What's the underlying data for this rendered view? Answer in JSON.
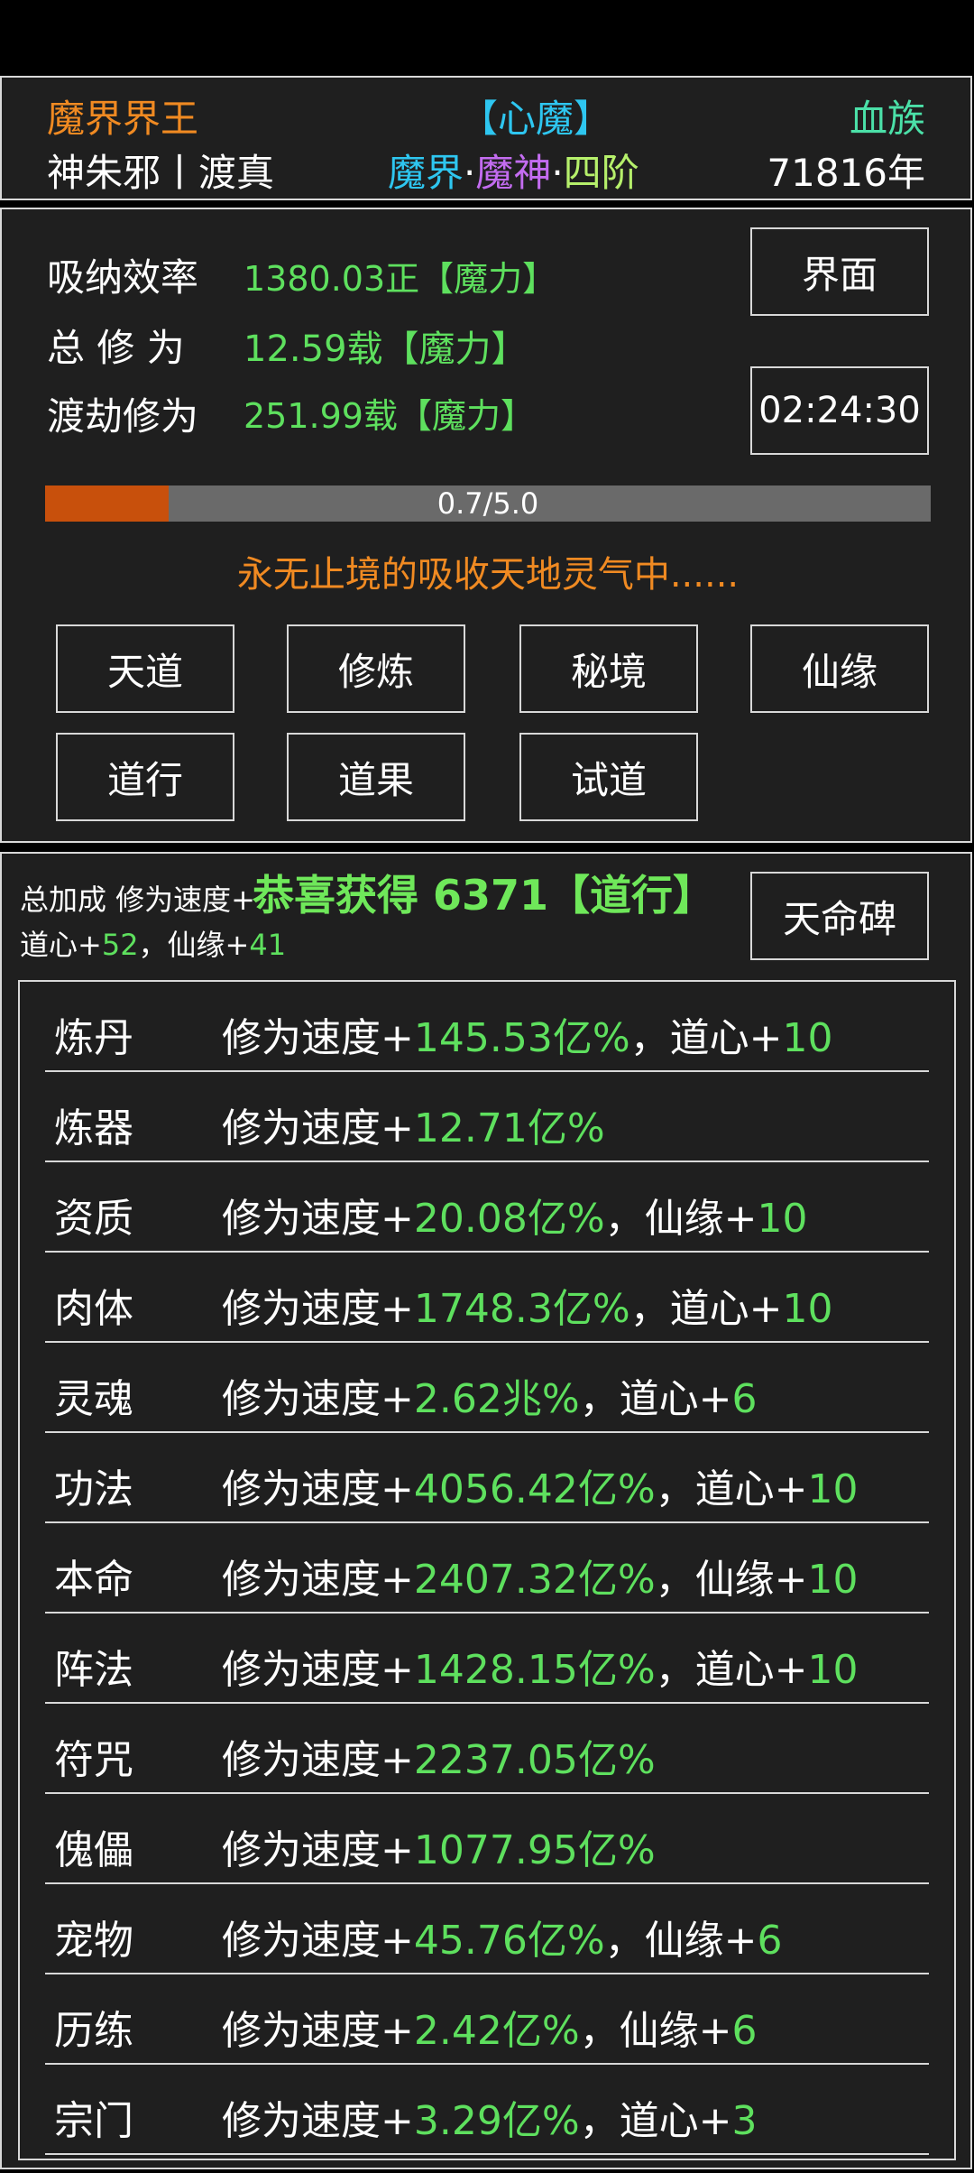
{
  "header": {
    "title": "魔界界王",
    "heart_demon": "【心魔】",
    "race": "血族",
    "name": "神朱邪丨渡真",
    "realm": {
      "world": "魔界",
      "dot1": "·",
      "rank": "魔神",
      "dot2": "·",
      "stage": "四阶"
    },
    "age": "71816年"
  },
  "stats": {
    "absorb_label": "吸纳效率",
    "absorb_value": "1380.03正【魔力】",
    "total_label": "总 修 为",
    "total_value": "12.59载【魔力】",
    "tribulation_label": "渡劫修为",
    "tribulation_value": "251.99载【魔力】",
    "interface_button": "界面",
    "timer": "02:24:30"
  },
  "progress": {
    "text": "0.7/5.0",
    "value": 0.7,
    "max": 5.0
  },
  "status_message": "永无止境的吸收天地灵气中......",
  "actions": [
    "天道",
    "修炼",
    "秘境",
    "仙缘",
    "道行",
    "道果",
    "试道"
  ],
  "bonus": {
    "prefix": "总加成 修为速度+",
    "toast": "恭喜获得 6371【道行】",
    "line2_a": "道心+",
    "line2_b": "52",
    "line2_c": "，仙缘+",
    "line2_d": "41",
    "tablet_button": "天命碑"
  },
  "bonus_list": [
    {
      "name": "炼丹",
      "a": "修为速度+",
      "b": "145.53亿%",
      "c": "，道心+",
      "d": "10"
    },
    {
      "name": "炼器",
      "a": "修为速度+",
      "b": "12.71亿%",
      "c": "",
      "d": ""
    },
    {
      "name": "资质",
      "a": "修为速度+",
      "b": "20.08亿%",
      "c": "，仙缘+",
      "d": "10"
    },
    {
      "name": "肉体",
      "a": "修为速度+",
      "b": "1748.3亿%",
      "c": "，道心+",
      "d": "10"
    },
    {
      "name": "灵魂",
      "a": "修为速度+",
      "b": "2.62兆%",
      "c": "，道心+",
      "d": "6"
    },
    {
      "name": "功法",
      "a": "修为速度+",
      "b": "4056.42亿%",
      "c": "，道心+",
      "d": "10"
    },
    {
      "name": "本命",
      "a": "修为速度+",
      "b": "2407.32亿%",
      "c": "，仙缘+",
      "d": "10"
    },
    {
      "name": "阵法",
      "a": "修为速度+",
      "b": "1428.15亿%",
      "c": "，道心+",
      "d": "10"
    },
    {
      "name": "符咒",
      "a": "修为速度+",
      "b": "2237.05亿%",
      "c": "",
      "d": ""
    },
    {
      "name": "傀儡",
      "a": "修为速度+",
      "b": "1077.95亿%",
      "c": "",
      "d": ""
    },
    {
      "name": "宠物",
      "a": "修为速度+",
      "b": "45.76亿%",
      "c": "，仙缘+",
      "d": "6"
    },
    {
      "name": "历练",
      "a": "修为速度+",
      "b": "2.42亿%",
      "c": "，仙缘+",
      "d": "6"
    },
    {
      "name": "宗门",
      "a": "修为速度+",
      "b": "3.29亿%",
      "c": "，道心+",
      "d": "3"
    }
  ],
  "colors": {
    "green": "#5ee05e",
    "orange": "#f08a22",
    "cyan": "#2ec6f0",
    "purple": "#c36cf0",
    "progress_fill": "#c8500c",
    "progress_track": "#6a6a6a"
  }
}
